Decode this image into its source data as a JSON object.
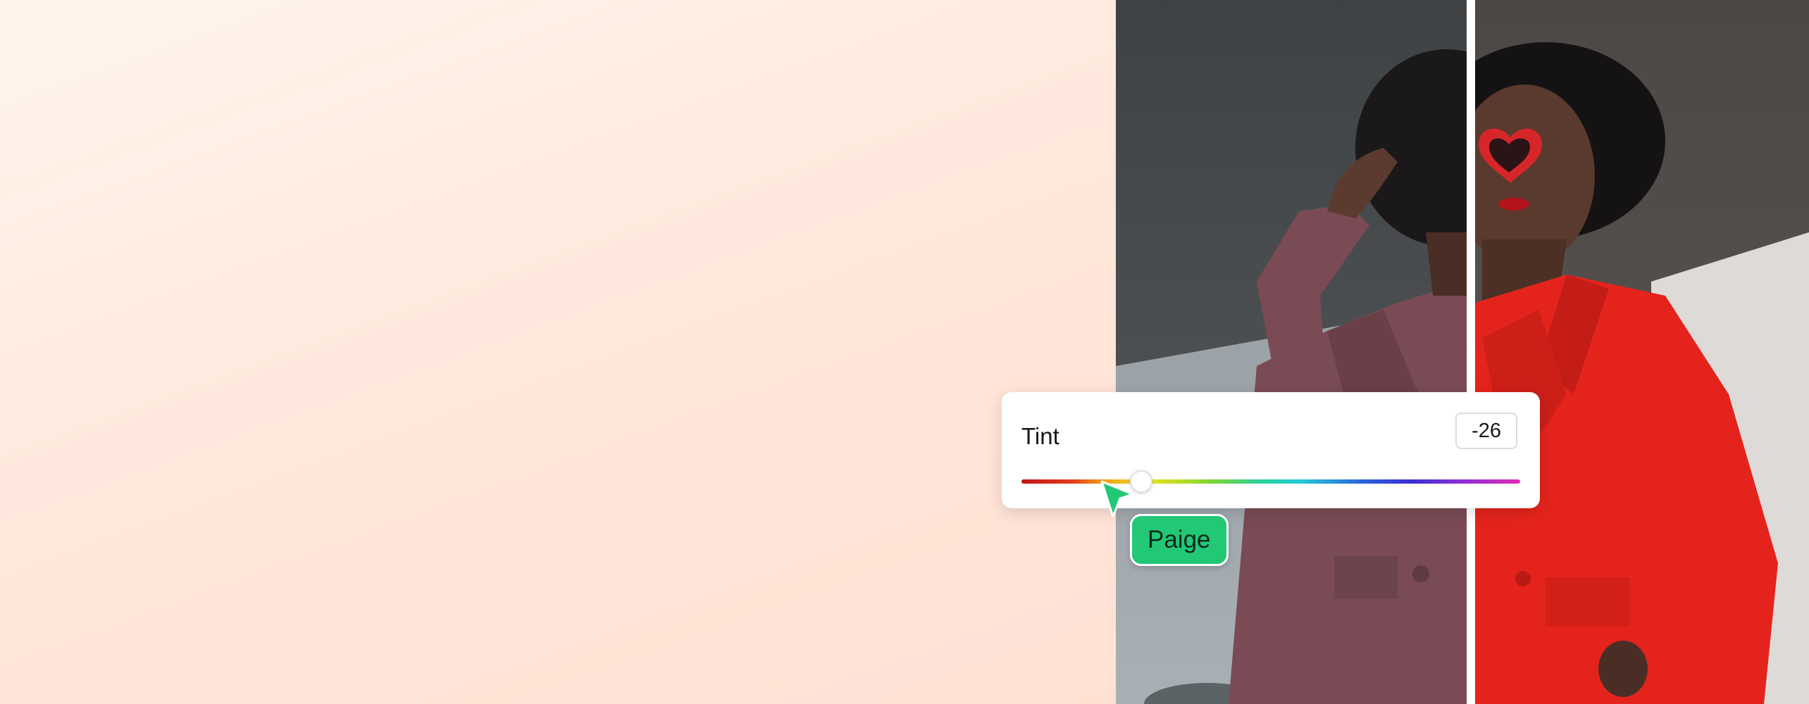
{
  "tint_control": {
    "label": "Tint",
    "value": "-26",
    "slider_position": 0.24
  },
  "collaborator": {
    "name": "Paige",
    "cursor_color": "#22c876"
  },
  "photo": {
    "left_half": "desaturated",
    "right_half": "original"
  },
  "colors": {
    "background": "#ffe6da",
    "jacket_original": "#e4241c",
    "jacket_adjusted": "#7a4b55",
    "panel": "#ffffff"
  }
}
